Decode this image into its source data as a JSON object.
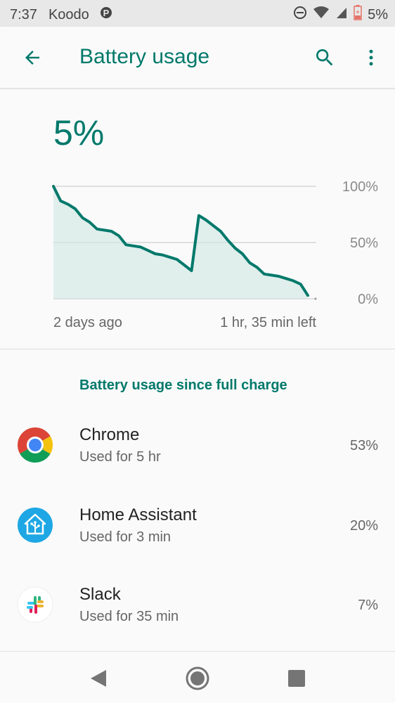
{
  "status_bar": {
    "time": "7:37",
    "carrier": "Koodo",
    "battery_pct": "5%",
    "icons": [
      "parking-icon",
      "do-not-disturb-icon",
      "wifi-icon",
      "signal-icon",
      "battery-icon"
    ]
  },
  "app_bar": {
    "title": "Battery usage",
    "back_icon": "arrow-left-icon",
    "search_icon": "search-icon",
    "more_icon": "more-vert-icon"
  },
  "summary": {
    "battery_level": "5%"
  },
  "chart_data": {
    "type": "area",
    "title": "",
    "xlabel": "",
    "ylabel": "",
    "x_labels": [
      "2 days ago",
      "1 hr, 35 min left"
    ],
    "y_ticks": [
      "100%",
      "50%",
      "0%"
    ],
    "ylim": [
      0,
      100
    ],
    "series": [
      {
        "values": [
          100,
          87,
          84,
          80,
          72,
          68,
          62,
          61,
          60,
          56,
          48,
          47,
          46,
          43,
          40,
          39,
          37,
          35,
          30,
          25,
          74,
          70,
          65,
          60,
          52,
          45,
          40,
          32,
          28,
          22,
          21,
          20,
          18,
          16,
          13,
          3
        ]
      }
    ],
    "grid": true,
    "color": "#00796b"
  },
  "section": {
    "title": "Battery usage since full charge"
  },
  "apps": [
    {
      "name": "Chrome",
      "usage": "Used for 5 hr",
      "percent": "53%",
      "icon": "chrome-icon"
    },
    {
      "name": "Home Assistant",
      "usage": "Used for 3 min",
      "percent": "20%",
      "icon": "home-assistant-icon"
    },
    {
      "name": "Slack",
      "usage": "Used for 35 min",
      "percent": "7%",
      "icon": "slack-icon"
    }
  ],
  "nav_bar": {
    "back_icon": "nav-back-icon",
    "home_icon": "nav-home-icon",
    "recents_icon": "nav-recents-icon"
  },
  "colors": {
    "accent": "#00796b",
    "chart_fill": "#cfe6e2"
  }
}
